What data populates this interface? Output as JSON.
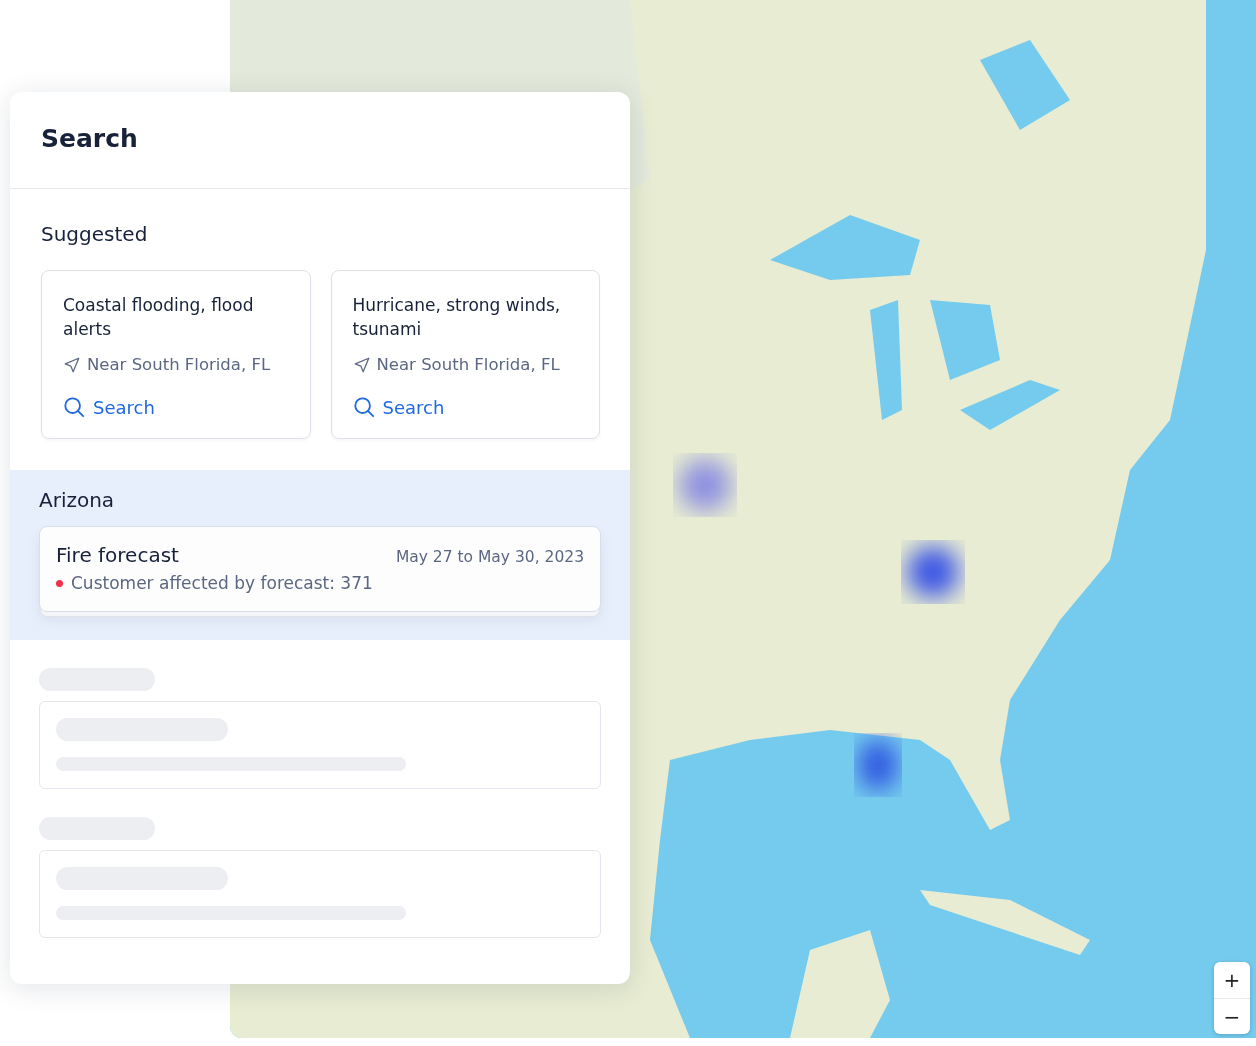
{
  "zoom_controls": [
    {
      "label": "+"
    },
    {
      "label": "−"
    }
  ],
  "panel": {
    "title": "Search"
  },
  "suggested": {
    "heading": "Suggested",
    "cards": [
      {
        "title": "Coastal flooding, flood alerts",
        "location": "Near South Florida, FL",
        "action": "Search"
      },
      {
        "title": "Hurricane, strong winds, tsunami",
        "location": "Near South Florida, FL",
        "action": "Search"
      }
    ]
  },
  "region": {
    "name": "Arizona",
    "selected": true,
    "result": {
      "title": "Fire forecast",
      "dates": "May 27 to May 30, 2023",
      "detail": "Customer affected by forecast: 371"
    }
  },
  "placeholders": [
    {
      "kind": "skeleton"
    },
    {
      "kind": "skeleton"
    }
  ]
}
